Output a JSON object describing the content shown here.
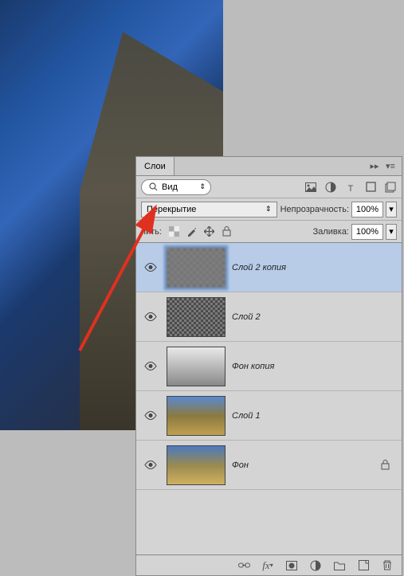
{
  "panel": {
    "title": "Слои",
    "search_label": "Вид",
    "blend_mode": "Перекрытие",
    "opacity_label": "Непрозрачность:",
    "opacity_value": "100%",
    "lock_label": "пить:",
    "fill_label": "Заливка:",
    "fill_value": "100%"
  },
  "layers": [
    {
      "name": "Слой 2 копия",
      "visible": true,
      "selected": true,
      "locked": false,
      "thumb": "noise"
    },
    {
      "name": "Слой 2",
      "visible": true,
      "selected": false,
      "locked": false,
      "thumb": "noise2"
    },
    {
      "name": "Фон копия",
      "visible": true,
      "selected": false,
      "locked": false,
      "thumb": "sketch"
    },
    {
      "name": "Слой 1",
      "visible": true,
      "selected": false,
      "locked": false,
      "thumb": "photo1"
    },
    {
      "name": "Фон",
      "visible": true,
      "selected": false,
      "locked": true,
      "thumb": "photo2"
    }
  ],
  "icons": {
    "search": "🔍",
    "collapse": "▸▸",
    "menu": "≡",
    "dd": "÷",
    "eye": "👁",
    "lock": "🔒"
  }
}
